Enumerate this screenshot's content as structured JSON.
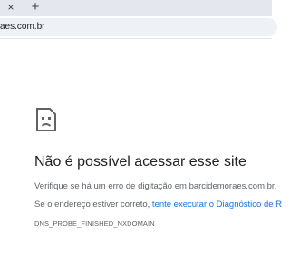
{
  "browser": {
    "tab_close_glyph": "×",
    "new_tab_glyph": "+",
    "url": "aes.com.br"
  },
  "error_page": {
    "icon": "sad-document-icon",
    "title": "Não é possível acessar esse site",
    "line1": "Verifique se há um erro de digitação em barcidemoraes.com.br.",
    "line2_prefix": "Se o endereço estiver correto, ",
    "line2_link": "tente executar o Diagnóstico de R",
    "error_code": "DNS_PROBE_FINISHED_NXDOMAIN"
  },
  "colors": {
    "link": "#1a73e8",
    "title": "#202124",
    "body_text": "#5f6368"
  }
}
